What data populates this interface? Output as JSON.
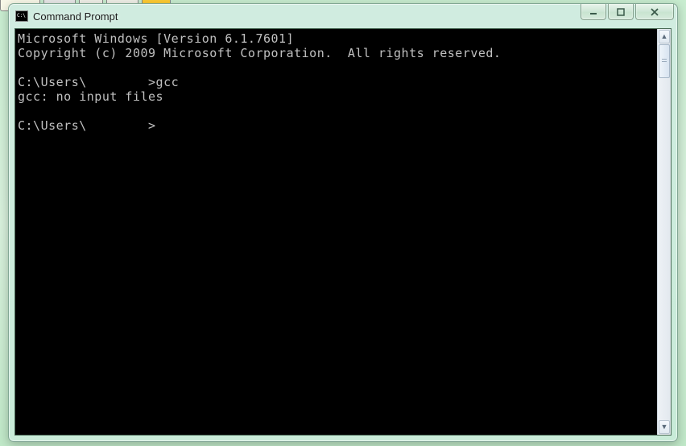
{
  "window": {
    "title": "Command Prompt"
  },
  "terminal": {
    "lines": [
      "Microsoft Windows [Version 6.1.7601]",
      "Copyright (c) 2009 Microsoft Corporation.  All rights reserved.",
      "",
      "C:\\Users\\        >gcc",
      "gcc: no input files",
      "",
      "C:\\Users\\        >"
    ]
  },
  "controls": {
    "minimize_label": "Minimize",
    "maximize_label": "Maximize",
    "close_label": "Close"
  },
  "scrollbar": {
    "up_glyph": "▲",
    "down_glyph": "▼"
  }
}
